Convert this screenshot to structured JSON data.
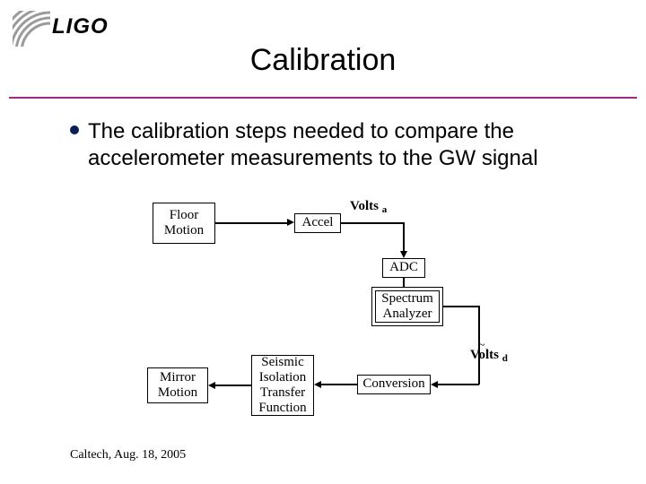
{
  "header": {
    "logo_text": "LIGO",
    "title": "Calibration"
  },
  "body": {
    "text": "The calibration steps needed to compare the accelerometer measurements to the GW signal"
  },
  "diagram": {
    "boxes": {
      "floor": [
        "Floor",
        "Motion"
      ],
      "accel": "Accel",
      "adc": "ADC",
      "spectrum": [
        "Spectrum",
        "Analyzer"
      ],
      "conversion": "Conversion",
      "seismic": [
        "Seismic",
        "Isolation",
        "Transfer",
        "Function"
      ],
      "mirror": [
        "Mirror",
        "Motion"
      ]
    },
    "labels": {
      "volts_a": "Volts",
      "volts_a_sub": "a",
      "volts_d": "Volts",
      "volts_d_sub": "d"
    }
  },
  "footer": {
    "text": "Caltech, Aug. 18, 2005"
  }
}
